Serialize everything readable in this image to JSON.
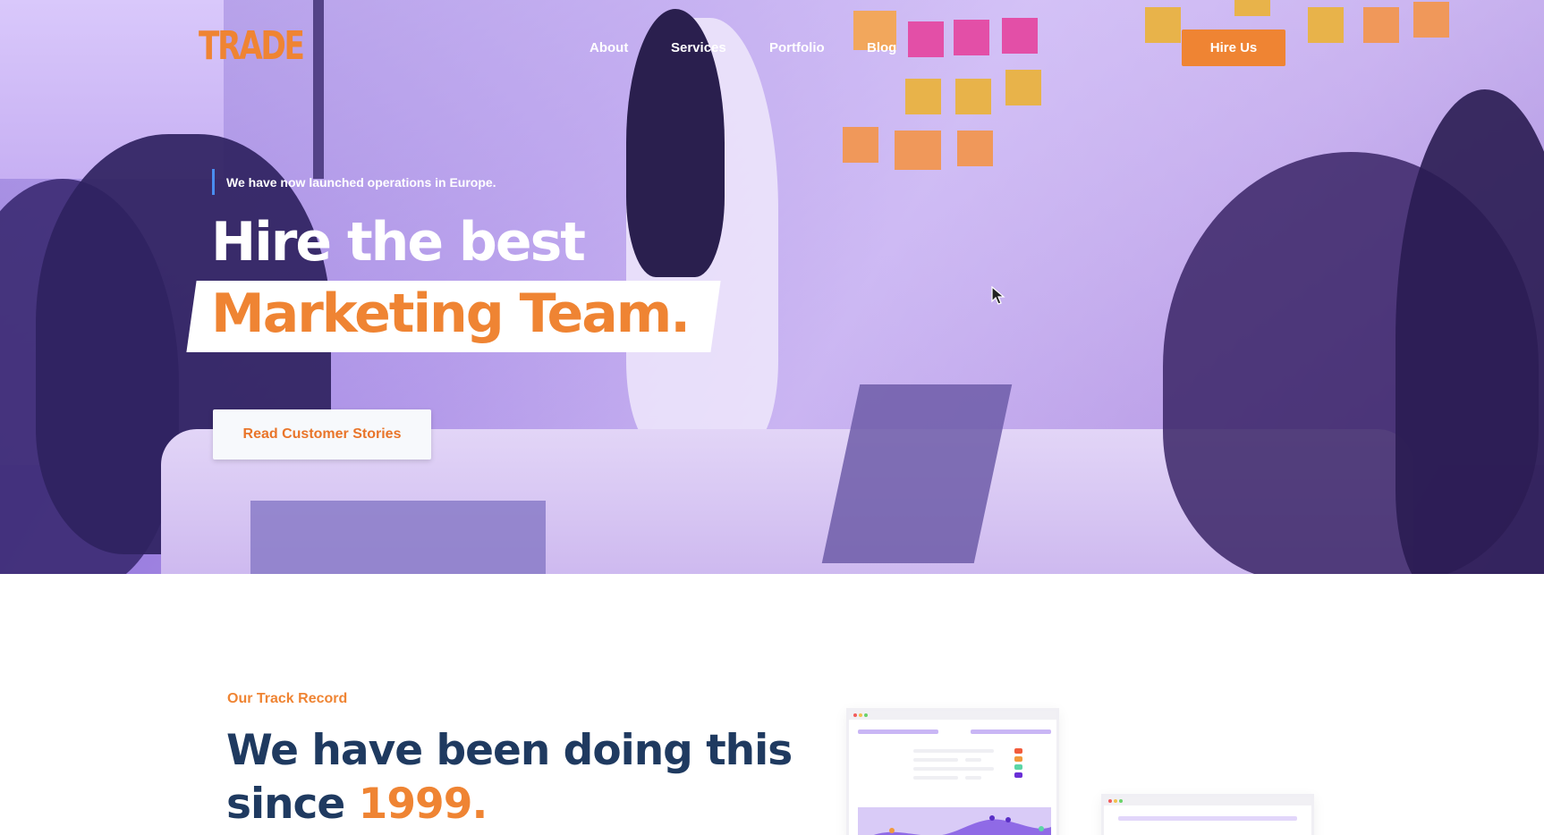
{
  "brand": {
    "logo_text": "TRADE",
    "accent": "#ef8433",
    "navy": "#1f3a60"
  },
  "nav": {
    "items": [
      "About",
      "Services",
      "Portfolio",
      "Blog"
    ],
    "cta_label": "Hire Us"
  },
  "hero": {
    "eyebrow": "We have now launched operations in Europe.",
    "headline_line1": "Hire the best",
    "headline_line2": "Marketing Team.",
    "cta_label": "Read Customer Stories"
  },
  "track_record": {
    "label": "Our Track Record",
    "heading_part1": "We have been doing this since ",
    "heading_year": "1999",
    "heading_end": "."
  },
  "icons": [
    "cursor-icon"
  ]
}
